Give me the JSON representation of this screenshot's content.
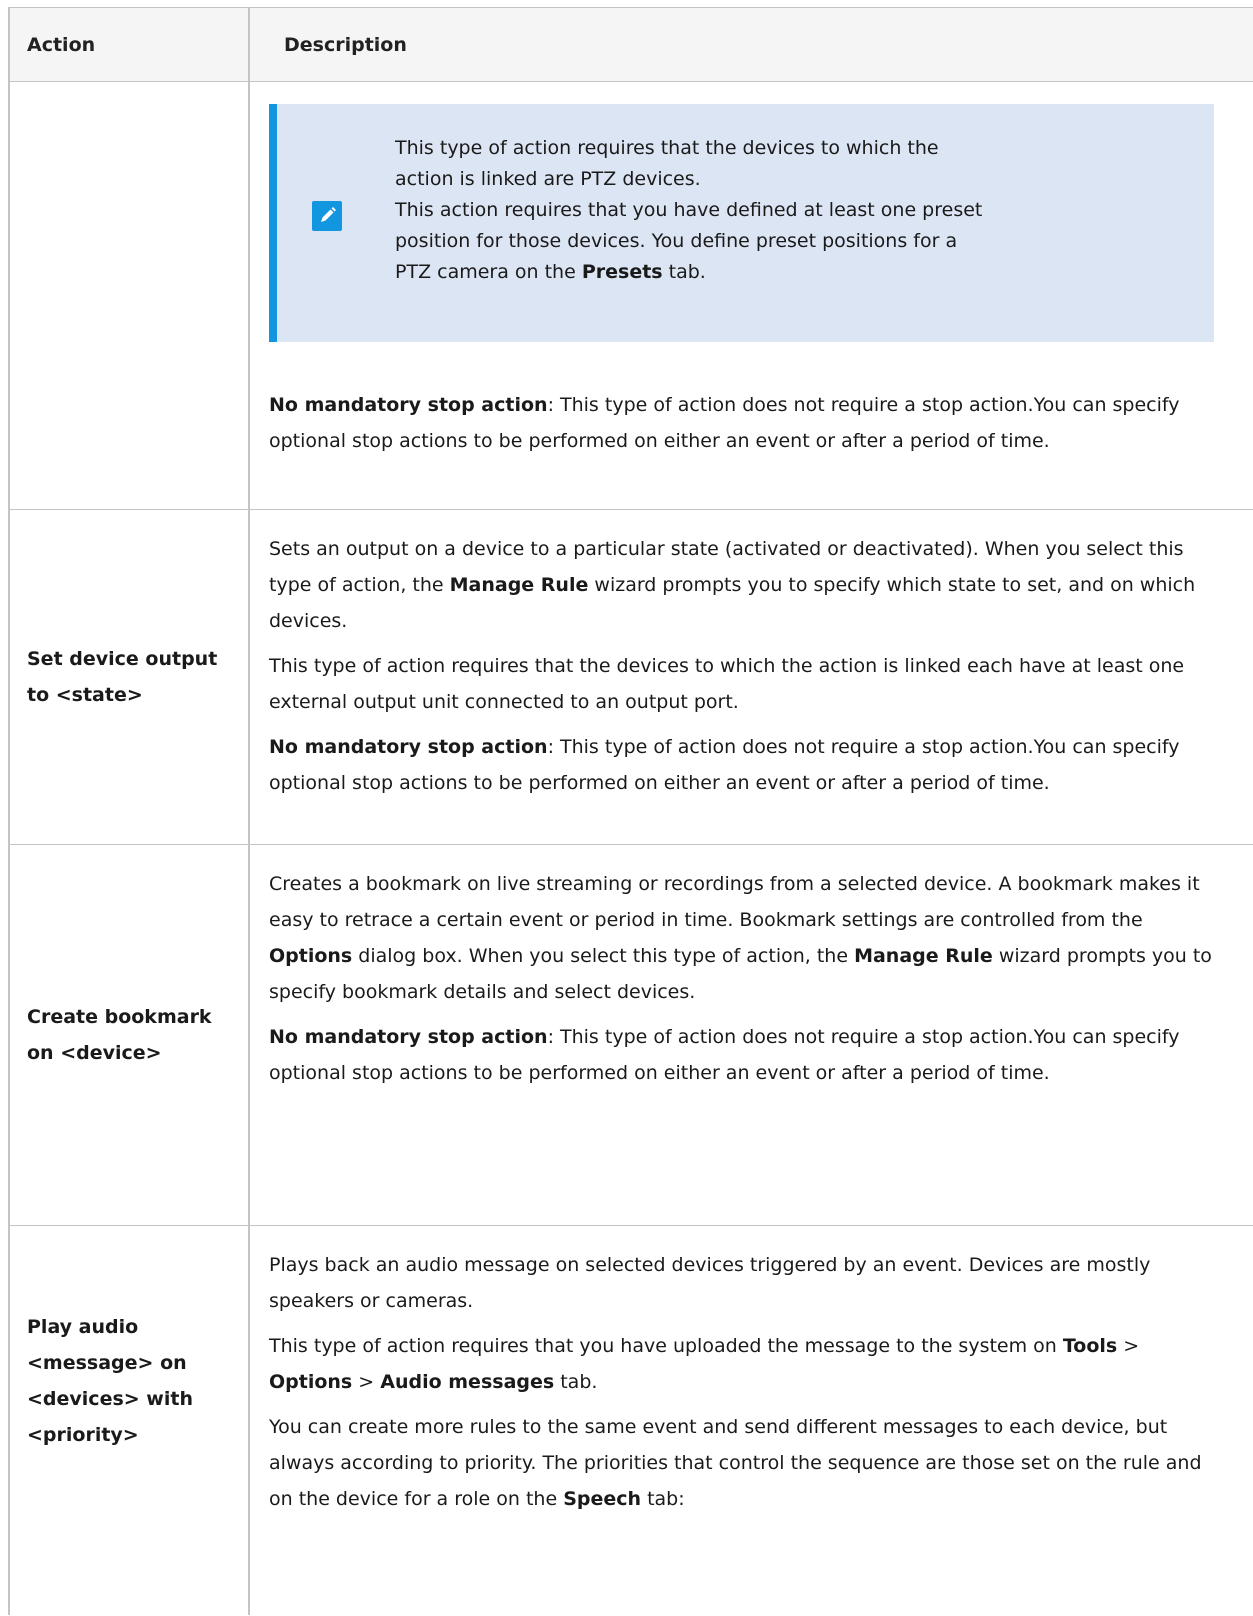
{
  "table": {
    "headers": {
      "action": "Action",
      "description": "Description"
    },
    "note": {
      "icon": "pencil-note-icon",
      "accent_color": "#1396e0",
      "background": "#dce5f3",
      "lines": [
        "This type of action requires that the devices to which the",
        "action is linked are PTZ devices.",
        "This action requires that you have defined at least one preset",
        "position for those devices. You define preset positions for a"
      ],
      "last_line_prefix": "PTZ camera on the ",
      "last_line_bold": "Presets",
      "last_line_suffix": " tab."
    },
    "rows": [
      {
        "action": "",
        "p1_bold": "No mandatory stop action",
        "p1_rest": ": This type of action does not require a stop action.You can specify optional stop actions to be performed on either an event or after a period of time."
      },
      {
        "action": "Set device output to <state>",
        "p1_a": "Sets an output on a device to a particular state (activated or deactivated). When you select this type of action, the ",
        "p1_b": "Manage Rule",
        "p1_c": " wizard prompts you to specify which state to set, and on which devices.",
        "p2": "This type of action requires that the devices to which the action is linked each have at least one external output unit connected to an output port.",
        "p3_bold": "No mandatory stop action",
        "p3_rest": ": This type of action does not require a stop action.You can specify optional stop actions to be performed on either an event or after a period of time."
      },
      {
        "action": "Create bookmark on <device>",
        "p1_a": "Creates a bookmark on live streaming or recordings from a selected device. A bookmark makes it easy to retrace a certain event or period in time. Bookmark settings are controlled from the ",
        "p1_b": "Options",
        "p1_c": " dialog box. When you select this type of action, the ",
        "p1_d": "Manage Rule",
        "p1_e": " wizard prompts you to specify bookmark details and select devices.",
        "p2_bold": "No mandatory stop action",
        "p2_rest": ": This type of action does not require a stop action.You can specify optional stop actions to be performed on either an event or after a period of time."
      },
      {
        "action": "Play audio <message> on <devices> with <priority>",
        "p1": "Plays back an audio message on selected devices triggered by an event. Devices are mostly speakers or cameras.",
        "p2_a": "This type of action requires that you have uploaded the message to the system on ",
        "p2_tools": "Tools",
        "p2_sep1": " > ",
        "p2_options": "Options",
        "p2_sep2": " > ",
        "p2_audio": "Audio messages",
        "p2_end": " tab.",
        "p3_a": "You can create more rules to the same event and send different messages to each device, but always according to priority. The priorities that control the sequence are those set on the rule and on the device for a role on the ",
        "p3_b": "Speech",
        "p3_c": " tab:"
      }
    ]
  }
}
